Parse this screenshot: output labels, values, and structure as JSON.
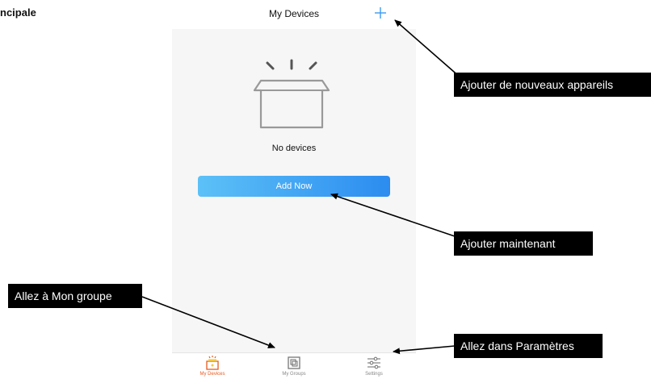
{
  "page_heading": "ncipale",
  "app": {
    "title": "My Devices",
    "empty_state": "No devices",
    "add_now_label": "Add Now"
  },
  "tabs": [
    {
      "label": "My Devices",
      "icon": "devices-icon",
      "active": true
    },
    {
      "label": "My Groups",
      "icon": "groups-icon",
      "active": false
    },
    {
      "label": "Settings",
      "icon": "settings-sliders-icon",
      "active": false
    }
  ],
  "callouts": {
    "add_devices": "Ajouter de nouveaux appareils",
    "add_now": "Ajouter maintenant",
    "go_group": "Allez à Mon groupe",
    "go_settings": "Allez dans Paramètres"
  },
  "colors": {
    "accent_blue": "#2c8cf0",
    "active_tab": "#e85a1f",
    "callout_bg": "#000000"
  }
}
